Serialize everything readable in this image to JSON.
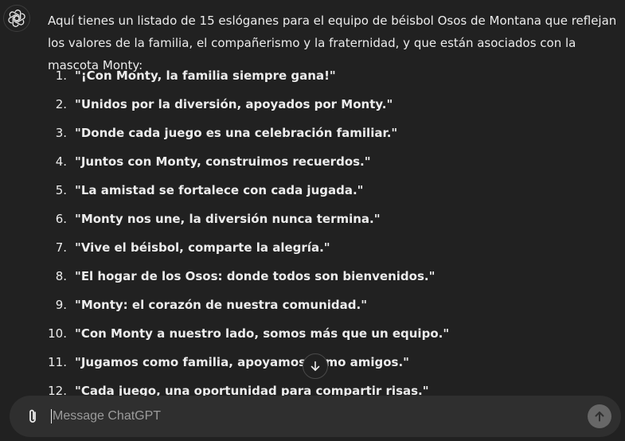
{
  "assistant": {
    "avatar_icon": "chatgpt-logo-icon",
    "intro": "Aquí tienes un listado de 15 eslóganes para el equipo de béisbol Osos de Montana que reflejan los valores de la familia, el compañerismo y la fraternidad, y que están asociados con la mascota Monty:",
    "slogans": [
      {
        "number": "1.",
        "text": "\"¡Con Monty, la familia siempre gana!\""
      },
      {
        "number": "2.",
        "text": "\"Unidos por la diversión, apoyados por Monty.\""
      },
      {
        "number": "3.",
        "text": "\"Donde cada juego es una celebración familiar.\""
      },
      {
        "number": "4.",
        "text": "\"Juntos con Monty, construimos recuerdos.\""
      },
      {
        "number": "5.",
        "text": "\"La amistad se fortalece con cada jugada.\""
      },
      {
        "number": "6.",
        "text": "\"Monty nos une, la diversión nunca termina.\""
      },
      {
        "number": "7.",
        "text": "\"Vive el béisbol, comparte la alegría.\""
      },
      {
        "number": "8.",
        "text": "\"El hogar de los Osos: donde todos son bienvenidos.\""
      },
      {
        "number": "9.",
        "text": "\"Monty: el corazón de nuestra comunidad.\""
      },
      {
        "number": "10.",
        "text": "\"Con Monty a nuestro lado, somos más que un equipo.\""
      },
      {
        "number": "11.",
        "text": "\"Jugamos como familia, apoyamos como amigos.\""
      },
      {
        "number": "12.",
        "text": "\"Cada juego, una oportunidad para compartir risas.\""
      }
    ]
  },
  "scroll_button": {
    "icon": "arrow-down-icon"
  },
  "composer": {
    "placeholder": "Message ChatGPT",
    "value": "",
    "attach_icon": "paperclip-icon",
    "send_icon": "arrow-up-icon"
  },
  "colors": {
    "background": "#212121",
    "text": "#ececec",
    "composer_bg": "#2f2f2f",
    "placeholder": "#9b9b9b",
    "send_button_bg": "#676767"
  }
}
